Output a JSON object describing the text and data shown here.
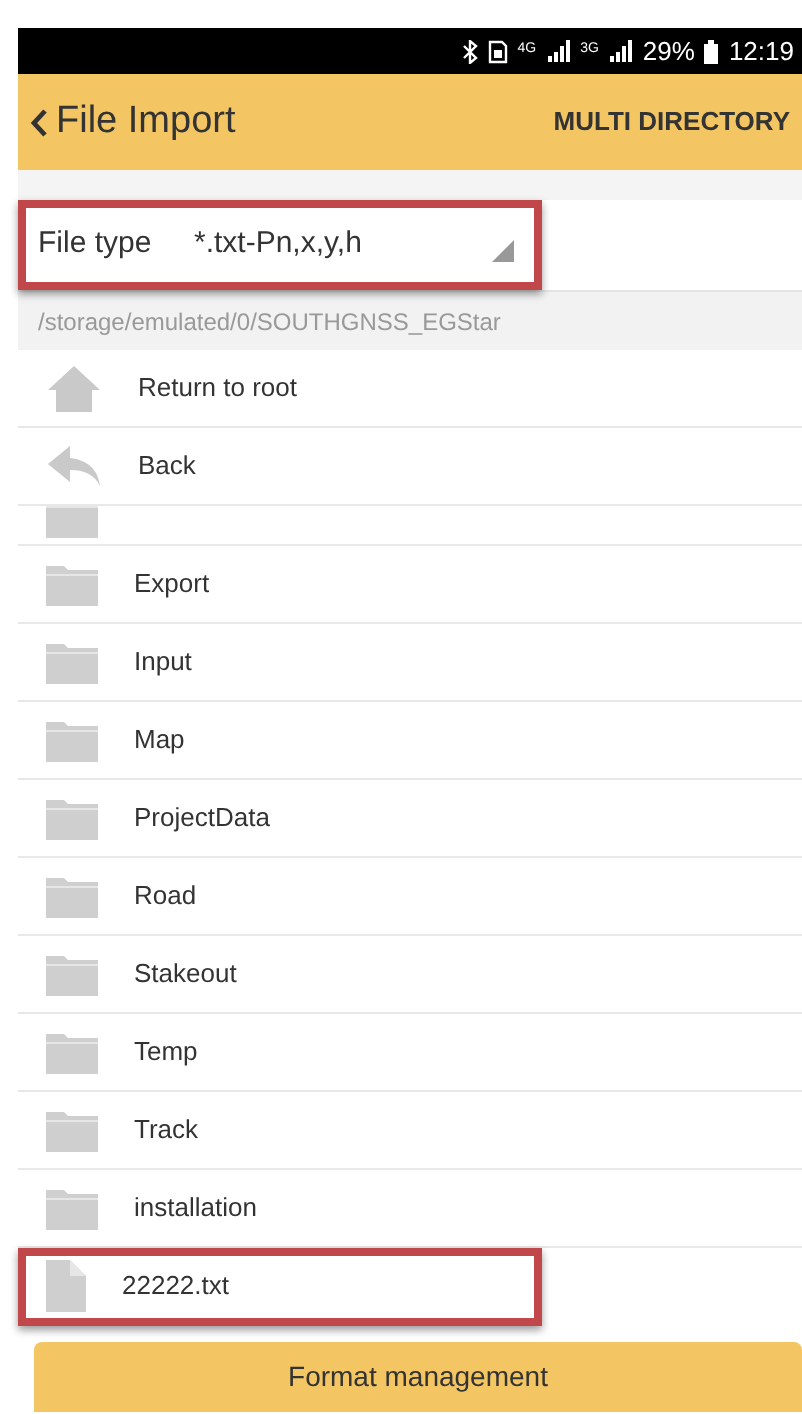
{
  "status_bar": {
    "network_4g": "4G",
    "network_3g": "3G",
    "battery": "29%",
    "time": "12:19"
  },
  "header": {
    "back_label": "File Import",
    "action": "MULTI DIRECTORY"
  },
  "file_type": {
    "label": "File type",
    "value": "*.txt-Pn,x,y,h",
    "highlighted": true
  },
  "path": "/storage/emulated/0/SOUTHGNSS_EGStar",
  "nav_items": [
    {
      "kind": "root",
      "label": "Return to root"
    },
    {
      "kind": "back",
      "label": "Back"
    }
  ],
  "entries": [
    {
      "kind": "folder",
      "highlighted": false,
      "partial": true
    },
    {
      "kind": "folder",
      "label": "Export",
      "highlighted": false,
      "partial": false
    },
    {
      "kind": "folder",
      "label": "Input",
      "highlighted": false,
      "partial": false
    },
    {
      "kind": "folder",
      "label": "Map",
      "highlighted": false,
      "partial": false
    },
    {
      "kind": "folder",
      "label": "ProjectData",
      "highlighted": false,
      "partial": false
    },
    {
      "kind": "folder",
      "label": "Road",
      "highlighted": false,
      "partial": false
    },
    {
      "kind": "folder",
      "label": "Stakeout",
      "highlighted": false,
      "partial": false
    },
    {
      "kind": "folder",
      "label": "Temp",
      "highlighted": false,
      "partial": false
    },
    {
      "kind": "folder",
      "label": "Track",
      "highlighted": false,
      "partial": false
    },
    {
      "kind": "folder",
      "label": "installation",
      "highlighted": false,
      "partial": false
    },
    {
      "kind": "file",
      "label": "22222.txt",
      "highlighted": true,
      "partial": false
    }
  ],
  "button": "Format management"
}
